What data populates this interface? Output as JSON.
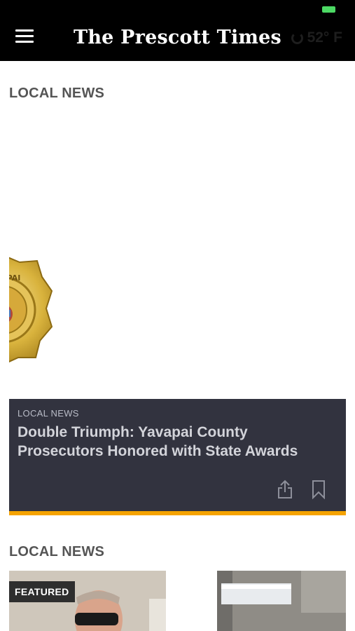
{
  "header": {
    "brand_title": "The Prescott Times",
    "weather_temp": "52° F",
    "weather_icon": "weather-icon"
  },
  "colors": {
    "accent": "#f5a300",
    "card_background": "#32333f",
    "battery": "#4cd964"
  },
  "sections": [
    {
      "title": "LOCAL NEWS"
    },
    {
      "title": "LOCAL NEWS"
    }
  ],
  "hero": {
    "category": "LOCAL NEWS",
    "headline": "Double Triumph: Yavapai County Prosecutors Honored with State Awards",
    "share_icon": "share-icon",
    "bookmark_icon": "bookmark-icon"
  },
  "thumbnails": [
    {
      "label": "FEATURED"
    },
    {
      "label": ""
    }
  ]
}
